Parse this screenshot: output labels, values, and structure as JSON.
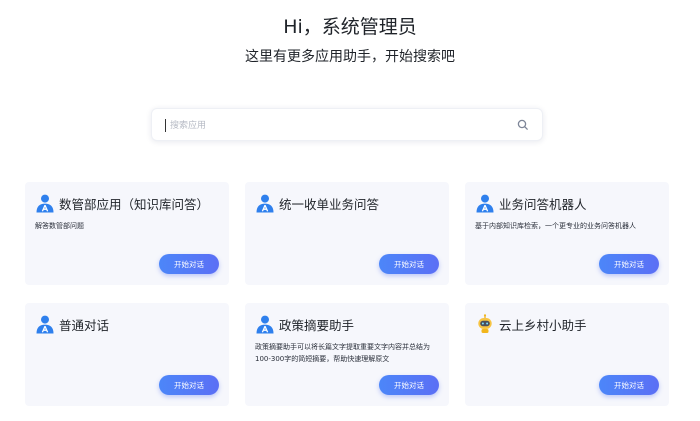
{
  "header": {
    "greeting": "Hi，系统管理员",
    "subtitle": "这里有更多应用助手，开始搜索吧"
  },
  "search": {
    "placeholder": "搜索应用",
    "value": ""
  },
  "cards": [
    {
      "title": "数管部应用（知识库问答）",
      "description": "解答数管部问题",
      "button": "开始对话",
      "avatar": "person-avatar-icon"
    },
    {
      "title": "统一收单业务问答",
      "description": "",
      "button": "开始对话",
      "avatar": "person-avatar-icon"
    },
    {
      "title": "业务问答机器人",
      "description": "基于内部知识库检索，一个更专业的业务问答机器人",
      "button": "开始对话",
      "avatar": "person-avatar-icon"
    },
    {
      "title": "普通对话",
      "description": "",
      "button": "开始对话",
      "avatar": "person-avatar-icon"
    },
    {
      "title": "政策摘要助手",
      "description": "政策摘要助手可以将长篇文字提取重要文字内容并总结为100-300字的简短摘要，帮助快速理解原文",
      "button": "开始对话",
      "avatar": "person-avatar-icon"
    },
    {
      "title": "云上乡村小助手",
      "description": "",
      "button": "开始对话",
      "avatar": "robot-avatar-icon"
    }
  ],
  "colors": {
    "accent": "#4c86f9",
    "card_bg": "#f6f7fc"
  }
}
